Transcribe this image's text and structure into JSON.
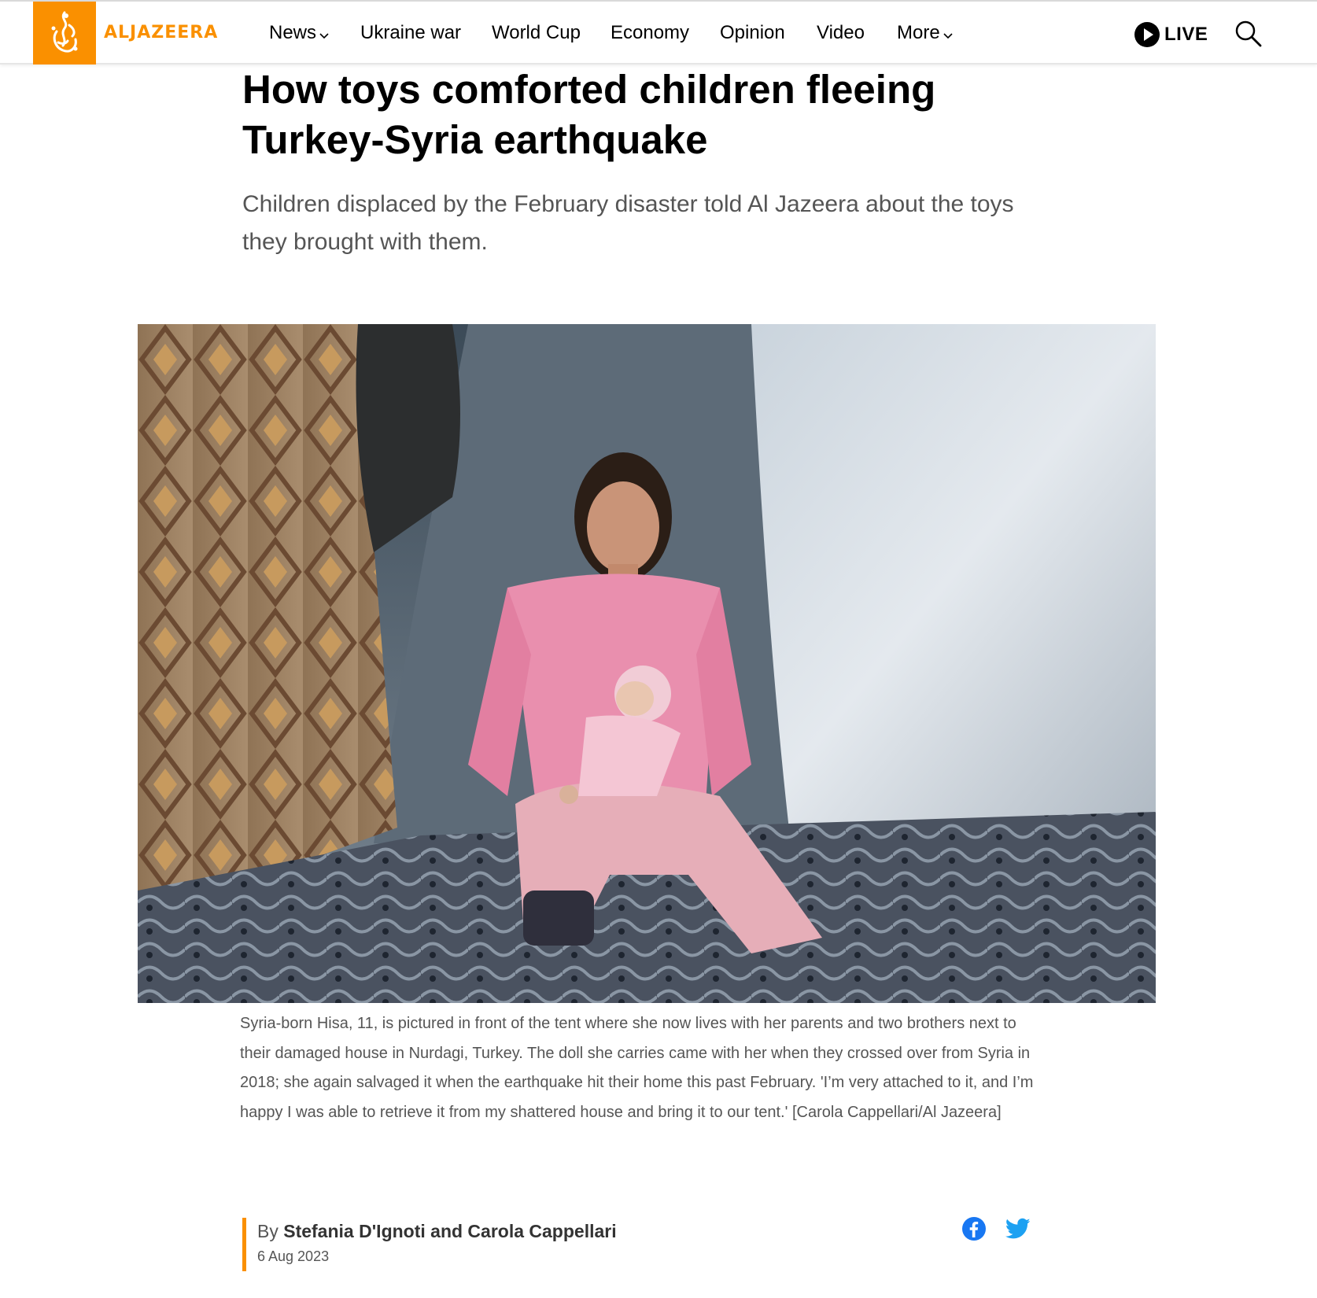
{
  "brand": {
    "name": "ALJAZEERA",
    "color": "#fa9000"
  },
  "nav": {
    "items": [
      {
        "label": "News",
        "dropdown": true
      },
      {
        "label": "Ukraine war",
        "dropdown": false
      },
      {
        "label": "World Cup",
        "dropdown": false
      },
      {
        "label": "Economy",
        "dropdown": false
      },
      {
        "label": "Opinion",
        "dropdown": false
      },
      {
        "label": "Video",
        "dropdown": false
      },
      {
        "label": "More",
        "dropdown": true
      }
    ],
    "live_label": "LIVE",
    "icons": [
      "play-icon",
      "search-icon",
      "chevron-down-icon"
    ]
  },
  "article": {
    "headline": "How toys comforted children fleeing Turkey-Syria earthquake",
    "subhead": "Children displaced by the February disaster told Al Jazeera about the toys they brought with them.",
    "image_caption": "Syria-born Hisa, 11, is pictured in front of the tent where she now lives with her parents and two brothers next to their damaged house in Nurdagi, Turkey. The doll she carries came with her when they crossed over from Syria in 2018; she again salvaged it when the earthquake hit their home this past February. 'I’m very attached to it, and I’m happy I was able to retrieve it from my shattered house and bring it to our tent.' [Carola Cappellari/Al Jazeera]",
    "byline_prefix": "By",
    "authors": "Stefania D'Ignoti and Carola Cappellari",
    "date": "6 Aug 2023"
  },
  "share": {
    "icons": [
      "facebook-icon",
      "twitter-icon"
    ],
    "facebook_color": "#1877f2",
    "twitter_color": "#1da1f2"
  }
}
